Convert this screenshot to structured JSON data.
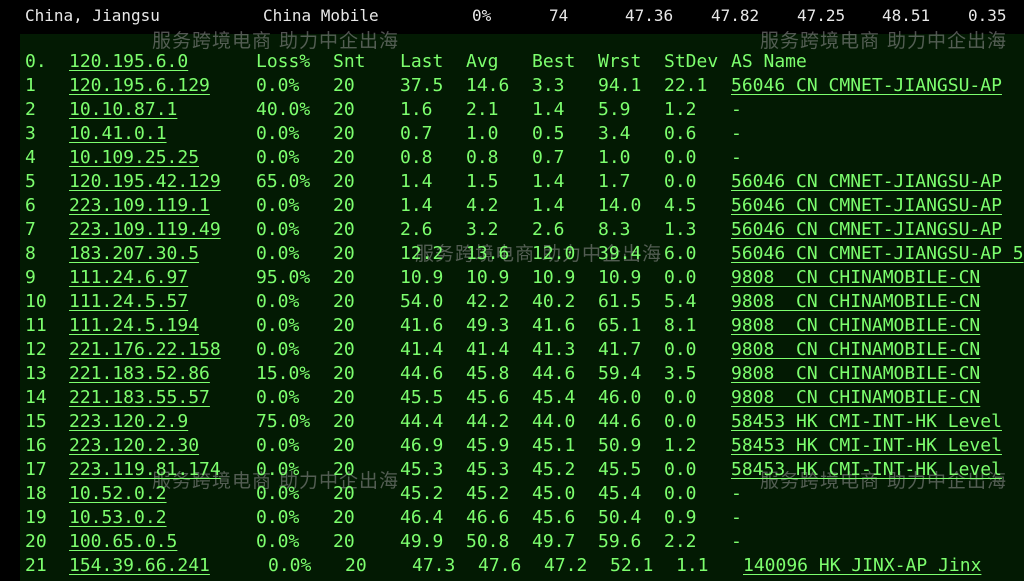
{
  "summary": {
    "location": "China, Jiangsu",
    "isp": "China Mobile",
    "loss": "0%",
    "sent": "74",
    "last": "47.36",
    "avg": "47.82",
    "best": "47.25",
    "worst": "48.51",
    "stdev": "0.35"
  },
  "watermarks": [
    "服务跨境电商 助力中企出海",
    "服务跨境电商 助力中企出海",
    "服务跨境电商 助力中企出海",
    "服务跨境电商 助力中企出海",
    "服务跨境电商 助力中企出海"
  ],
  "headers": {
    "hop": "0.",
    "host": "120.195.6.0",
    "loss": "Loss%",
    "snt": "Snt",
    "last": "Last",
    "avg": "Avg",
    "best": "Best",
    "wrst": "Wrst",
    "stdev": "StDev",
    "as": "AS Name"
  },
  "hops": [
    {
      "hop": "1",
      "host": "120.195.6.129",
      "loss": "0.0%",
      "snt": "20",
      "last": "37.5",
      "avg": "14.6",
      "best": "3.3",
      "wrst": "94.1",
      "stdev": "22.1",
      "as": "56046 CN CMNET-JIANGSU-AP"
    },
    {
      "hop": "2",
      "host": "10.10.87.1",
      "loss": "40.0%",
      "snt": "20",
      "last": "1.6",
      "avg": "2.1",
      "best": "1.4",
      "wrst": "5.9",
      "stdev": "1.2",
      "as": "-"
    },
    {
      "hop": "3",
      "host": "10.41.0.1",
      "loss": "0.0%",
      "snt": "20",
      "last": "0.7",
      "avg": "1.0",
      "best": "0.5",
      "wrst": "3.4",
      "stdev": "0.6",
      "as": "-"
    },
    {
      "hop": "4",
      "host": "10.109.25.25",
      "loss": "0.0%",
      "snt": "20",
      "last": "0.8",
      "avg": "0.8",
      "best": "0.7",
      "wrst": "1.0",
      "stdev": "0.0",
      "as": "-"
    },
    {
      "hop": "5",
      "host": "120.195.42.129",
      "loss": "65.0%",
      "snt": "20",
      "last": "1.4",
      "avg": "1.5",
      "best": "1.4",
      "wrst": "1.7",
      "stdev": "0.0",
      "as": "56046 CN CMNET-JIANGSU-AP"
    },
    {
      "hop": "6",
      "host": "223.109.119.1",
      "loss": "0.0%",
      "snt": "20",
      "last": "1.4",
      "avg": "4.2",
      "best": "1.4",
      "wrst": "14.0",
      "stdev": "4.5",
      "as": "56046 CN CMNET-JIANGSU-AP"
    },
    {
      "hop": "7",
      "host": "223.109.119.49",
      "loss": "0.0%",
      "snt": "20",
      "last": "2.6",
      "avg": "3.2",
      "best": "2.6",
      "wrst": "8.3",
      "stdev": "1.3",
      "as": "56046 CN CMNET-JIANGSU-AP"
    },
    {
      "hop": "8",
      "host": "183.207.30.5",
      "loss": "0.0%",
      "snt": "20",
      "last": "12.2",
      "avg": "13.6",
      "best": "12.0",
      "wrst": "39.4",
      "stdev": "6.0",
      "as": "56046 CN CMNET-JIANGSU-AP 5"
    },
    {
      "hop": "9",
      "host": "111.24.6.97",
      "loss": "95.0%",
      "snt": "20",
      "last": "10.9",
      "avg": "10.9",
      "best": "10.9",
      "wrst": "10.9",
      "stdev": "0.0",
      "as": "9808  CN CHINAMOBILE-CN"
    },
    {
      "hop": "10",
      "host": "111.24.5.57",
      "loss": "0.0%",
      "snt": "20",
      "last": "54.0",
      "avg": "42.2",
      "best": "40.2",
      "wrst": "61.5",
      "stdev": "5.4",
      "as": "9808  CN CHINAMOBILE-CN"
    },
    {
      "hop": "11",
      "host": "111.24.5.194",
      "loss": "0.0%",
      "snt": "20",
      "last": "41.6",
      "avg": "49.3",
      "best": "41.6",
      "wrst": "65.1",
      "stdev": "8.1",
      "as": "9808  CN CHINAMOBILE-CN"
    },
    {
      "hop": "12",
      "host": "221.176.22.158",
      "loss": "0.0%",
      "snt": "20",
      "last": "41.4",
      "avg": "41.4",
      "best": "41.3",
      "wrst": "41.7",
      "stdev": "0.0",
      "as": "9808  CN CHINAMOBILE-CN"
    },
    {
      "hop": "13",
      "host": "221.183.52.86",
      "loss": "15.0%",
      "snt": "20",
      "last": "44.6",
      "avg": "45.8",
      "best": "44.6",
      "wrst": "59.4",
      "stdev": "3.5",
      "as": "9808  CN CHINAMOBILE-CN"
    },
    {
      "hop": "14",
      "host": "221.183.55.57",
      "loss": "0.0%",
      "snt": "20",
      "last": "45.5",
      "avg": "45.6",
      "best": "45.4",
      "wrst": "46.0",
      "stdev": "0.0",
      "as": "9808  CN CHINAMOBILE-CN"
    },
    {
      "hop": "15",
      "host": "223.120.2.9",
      "loss": "75.0%",
      "snt": "20",
      "last": "44.4",
      "avg": "44.2",
      "best": "44.0",
      "wrst": "44.6",
      "stdev": "0.0",
      "as": "58453 HK CMI-INT-HK Level"
    },
    {
      "hop": "16",
      "host": "223.120.2.30",
      "loss": "0.0%",
      "snt": "20",
      "last": "46.9",
      "avg": "45.9",
      "best": "45.1",
      "wrst": "50.9",
      "stdev": "1.2",
      "as": "58453 HK CMI-INT-HK Level"
    },
    {
      "hop": "17",
      "host": "223.119.81.174",
      "loss": "0.0%",
      "snt": "20",
      "last": "45.3",
      "avg": "45.3",
      "best": "45.2",
      "wrst": "45.5",
      "stdev": "0.0",
      "as": "58453 HK CMI-INT-HK Level"
    },
    {
      "hop": "18",
      "host": "10.52.0.2",
      "loss": "0.0%",
      "snt": "20",
      "last": "45.2",
      "avg": "45.2",
      "best": "45.0",
      "wrst": "45.4",
      "stdev": "0.0",
      "as": "-"
    },
    {
      "hop": "19",
      "host": "10.53.0.2",
      "loss": "0.0%",
      "snt": "20",
      "last": "46.4",
      "avg": "46.6",
      "best": "45.6",
      "wrst": "50.4",
      "stdev": "0.9",
      "as": "-"
    },
    {
      "hop": "20",
      "host": "100.65.0.5",
      "loss": "0.0%",
      "snt": "20",
      "last": "49.9",
      "avg": "50.8",
      "best": "49.7",
      "wrst": "59.6",
      "stdev": "2.2",
      "as": "-"
    }
  ],
  "last_row": {
    "hop": "21",
    "host": "154.39.66.241",
    "loss": "0.0%",
    "snt": "20",
    "last": "47.3",
    "avg": "47.6",
    "best": "47.2",
    "wrst": "52.1",
    "stdev": "1.1",
    "as": "140096 HK JINX-AP Jinx"
  },
  "colors": {
    "text": "#7dff6e",
    "panel": "#031a03",
    "background": "#000000",
    "summary_text": "#e8e8e8"
  }
}
